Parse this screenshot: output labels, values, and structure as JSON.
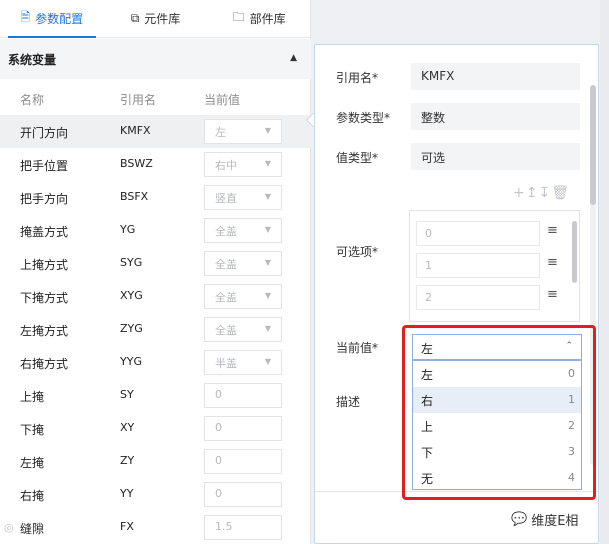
{
  "tabs": [
    {
      "label": "参数配置",
      "icon": "document-icon",
      "active": true
    },
    {
      "label": "元件库",
      "icon": "component-icon",
      "active": false
    },
    {
      "label": "部件库",
      "icon": "folder-icon",
      "active": false
    }
  ],
  "section": {
    "title": "系统变量"
  },
  "columns": {
    "name": "名称",
    "ref": "引用名",
    "value": "当前值"
  },
  "variables": [
    {
      "name": "开门方向",
      "ref": "KMFX",
      "value": "左",
      "dropdown": true
    },
    {
      "name": "把手位置",
      "ref": "BSWZ",
      "value": "右中",
      "dropdown": true
    },
    {
      "name": "把手方向",
      "ref": "BSFX",
      "value": "竖直",
      "dropdown": true
    },
    {
      "name": "掩盖方式",
      "ref": "YG",
      "value": "全盖",
      "dropdown": true
    },
    {
      "name": "上掩方式",
      "ref": "SYG",
      "value": "全盖",
      "dropdown": true
    },
    {
      "name": "下掩方式",
      "ref": "XYG",
      "value": "全盖",
      "dropdown": true
    },
    {
      "name": "左掩方式",
      "ref": "ZYG",
      "value": "全盖",
      "dropdown": true
    },
    {
      "name": "右掩方式",
      "ref": "YYG",
      "value": "半盖",
      "dropdown": true
    },
    {
      "name": "上掩",
      "ref": "SY",
      "value": "0",
      "dropdown": false
    },
    {
      "name": "下掩",
      "ref": "XY",
      "value": "0",
      "dropdown": false
    },
    {
      "name": "左掩",
      "ref": "ZY",
      "value": "0",
      "dropdown": false
    },
    {
      "name": "右掩",
      "ref": "YY",
      "value": "0",
      "dropdown": false
    },
    {
      "name": "缝隙",
      "ref": "FX",
      "value": "1.5",
      "dropdown": false
    }
  ],
  "detail": {
    "ref_label": "引用名*",
    "ref_value": "KMFX",
    "type_label": "参数类型*",
    "type_value": "整数",
    "valtype_label": "值类型*",
    "valtype_value": "可选",
    "options_label": "可选项*",
    "options": [
      "0",
      "1",
      "2"
    ],
    "current_label": "当前值*",
    "current_value": "左",
    "desc_label": "描述"
  },
  "dropdown_options": [
    {
      "label": "左",
      "index": "0"
    },
    {
      "label": "右",
      "index": "1"
    },
    {
      "label": "上",
      "index": "2"
    },
    {
      "label": "下",
      "index": "3"
    },
    {
      "label": "无",
      "index": "4"
    }
  ],
  "footer": {
    "brand": "维度E相"
  },
  "colors": {
    "accent": "#1677e6",
    "highlight_frame": "#e0201a"
  }
}
